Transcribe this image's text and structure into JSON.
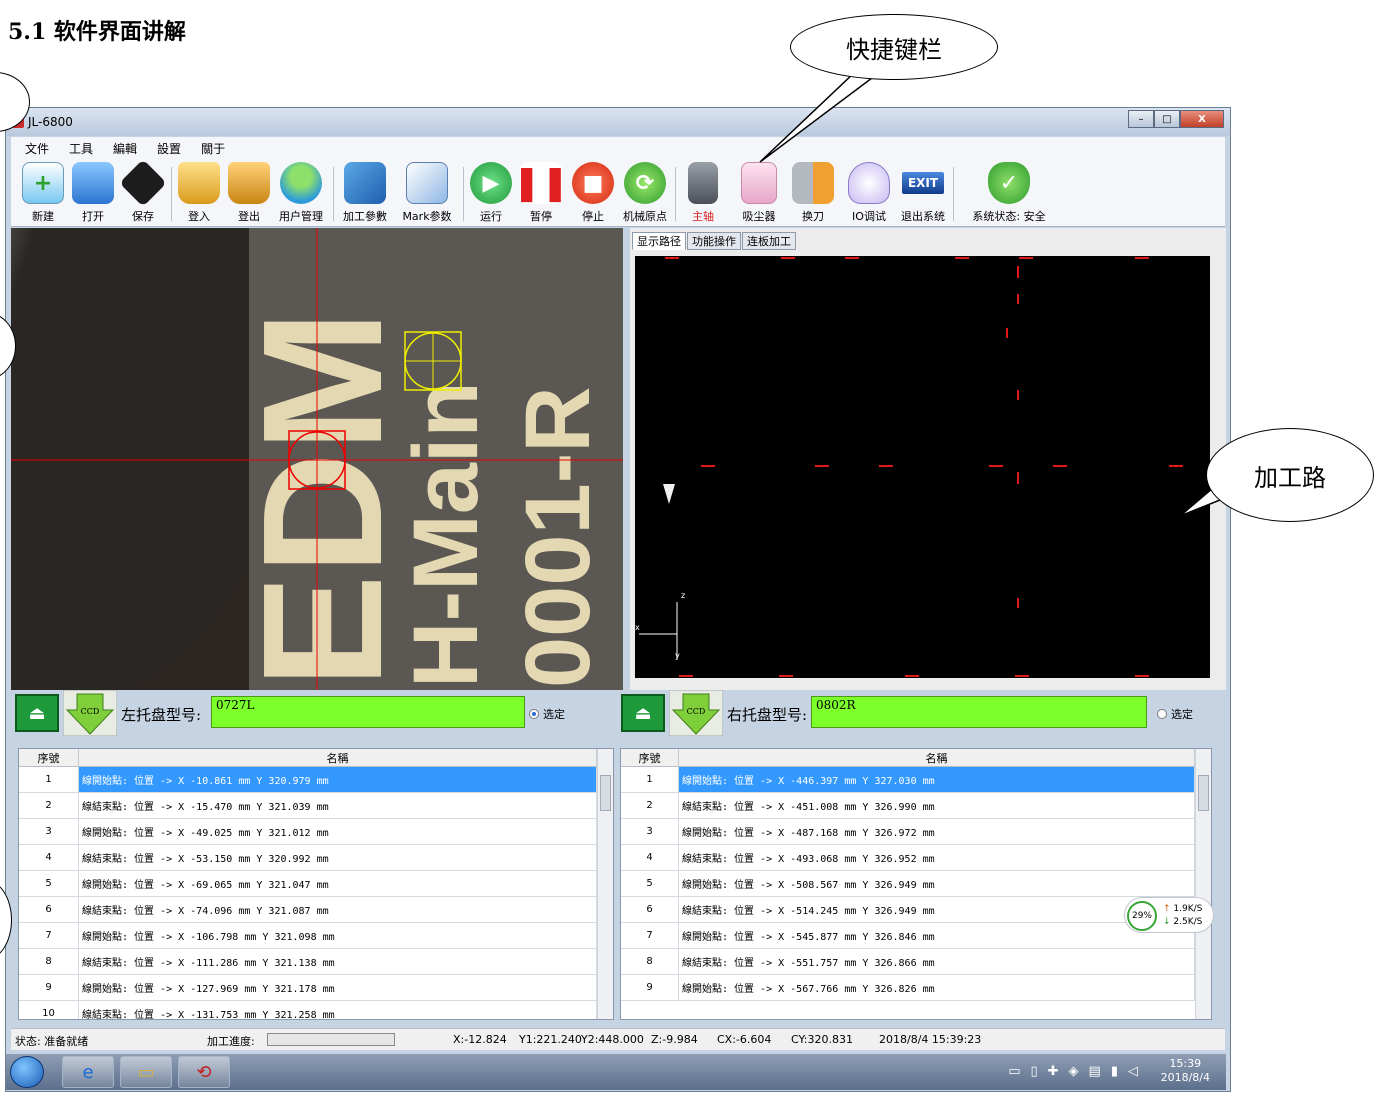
{
  "doc_heading": "5.1 软件界面讲解",
  "callouts": {
    "shortcut_bar": "快捷键栏",
    "process_path": "加工路"
  },
  "window": {
    "title": "JL-6800",
    "controls": {
      "minimize": "–",
      "maximize": "□",
      "close": "X"
    }
  },
  "menu": [
    "文件",
    "工具",
    "編輯",
    "設置",
    "關于"
  ],
  "toolbar": {
    "new": "新建",
    "open": "打开",
    "save": "保存",
    "login": "登入",
    "logout": "登出",
    "user_mgmt": "用户管理",
    "process_params": "加工參數",
    "mark_params": "Mark参数",
    "run": "运行",
    "pause": "暂停",
    "stop": "停止",
    "machine_origin": "机械原点",
    "spindle": "主轴",
    "vacuum": "吸尘器",
    "tool_change": "换刀",
    "io_debug": "IO调试",
    "exit_system": "退出系统",
    "system_status": "系统状态: 安全",
    "exit_badge": "EXIT"
  },
  "camera": {
    "pcb_text_1": "EDM",
    "pcb_text_2": "H-Main",
    "pcb_text_3": "0001-R"
  },
  "tabs": [
    "显示路径",
    "功能操作",
    "连板加工"
  ],
  "left_tray": {
    "label": "左托盘型号:",
    "value": "0727L",
    "select_label": "选定",
    "ccd": "CCD"
  },
  "right_tray": {
    "label": "右托盘型号:",
    "value": "0802R",
    "select_label": "选定",
    "ccd": "CCD"
  },
  "grid_headers": {
    "index": "序號",
    "name": "名稱"
  },
  "left_rows": [
    {
      "idx": "1",
      "name": "線開始點:  位置 -> X -10.861 mm  Y 320.979 mm"
    },
    {
      "idx": "2",
      "name": "線結束點:  位置 -> X -15.470 mm  Y 321.039 mm"
    },
    {
      "idx": "3",
      "name": "線開始點:  位置 -> X -49.025 mm  Y 321.012 mm"
    },
    {
      "idx": "4",
      "name": "線結束點:  位置 -> X -53.150 mm  Y 320.992 mm"
    },
    {
      "idx": "5",
      "name": "線開始點:  位置 -> X -69.065 mm  Y 321.047 mm"
    },
    {
      "idx": "6",
      "name": "線結束點:  位置 -> X -74.096 mm  Y 321.087 mm"
    },
    {
      "idx": "7",
      "name": "線開始點:  位置 -> X -106.798 mm  Y 321.098 mm"
    },
    {
      "idx": "8",
      "name": "線結束點:  位置 -> X -111.286 mm  Y 321.138 mm"
    },
    {
      "idx": "9",
      "name": "線開始點:  位置 -> X -127.969 mm  Y 321.178 mm"
    },
    {
      "idx": "10",
      "name": "線結束點:  位置 -> X -131.753 mm  Y 321.258 mm"
    }
  ],
  "right_rows": [
    {
      "idx": "1",
      "name": "線開始點:  位置 -> X -446.397 mm  Y 327.030 mm"
    },
    {
      "idx": "2",
      "name": "線結束點:  位置 -> X -451.008 mm  Y 326.990 mm"
    },
    {
      "idx": "3",
      "name": "線開始點:  位置 -> X -487.168 mm  Y 326.972 mm"
    },
    {
      "idx": "4",
      "name": "線結束點:  位置 -> X -493.068 mm  Y 326.952 mm"
    },
    {
      "idx": "5",
      "name": "線開始點:  位置 -> X -508.567 mm  Y 326.949 mm"
    },
    {
      "idx": "6",
      "name": "線結束點:  位置 -> X -514.245 mm  Y 326.949 mm"
    },
    {
      "idx": "7",
      "name": "線開始點:  位置 -> X -545.877 mm  Y 326.846 mm"
    },
    {
      "idx": "8",
      "name": "線結束點:  位置 -> X -551.757 mm  Y 326.866 mm"
    },
    {
      "idx": "9",
      "name": "線開始點:  位置 -> X -567.766 mm  Y 326.826 mm"
    }
  ],
  "status": {
    "state": "状态: 准备就绪",
    "progress_label": "加工進度:",
    "x": "X:-12.824",
    "y1": "Y1:221.240",
    "y2": "Y2:448.000",
    "z": "Z:-9.984",
    "cx": "CX:-6.604",
    "cy": "CY:320.831",
    "datetime": "2018/8/4 15:39:23"
  },
  "network": {
    "percent": "29%",
    "up": "1.9K/S",
    "down": "2.5K/S"
  },
  "taskbar": {
    "time": "15:39",
    "date": "2018/8/4"
  },
  "colors": {
    "tray_green": "#7dff2c",
    "selection_blue": "#3399ff",
    "path_red": "#e01818"
  }
}
